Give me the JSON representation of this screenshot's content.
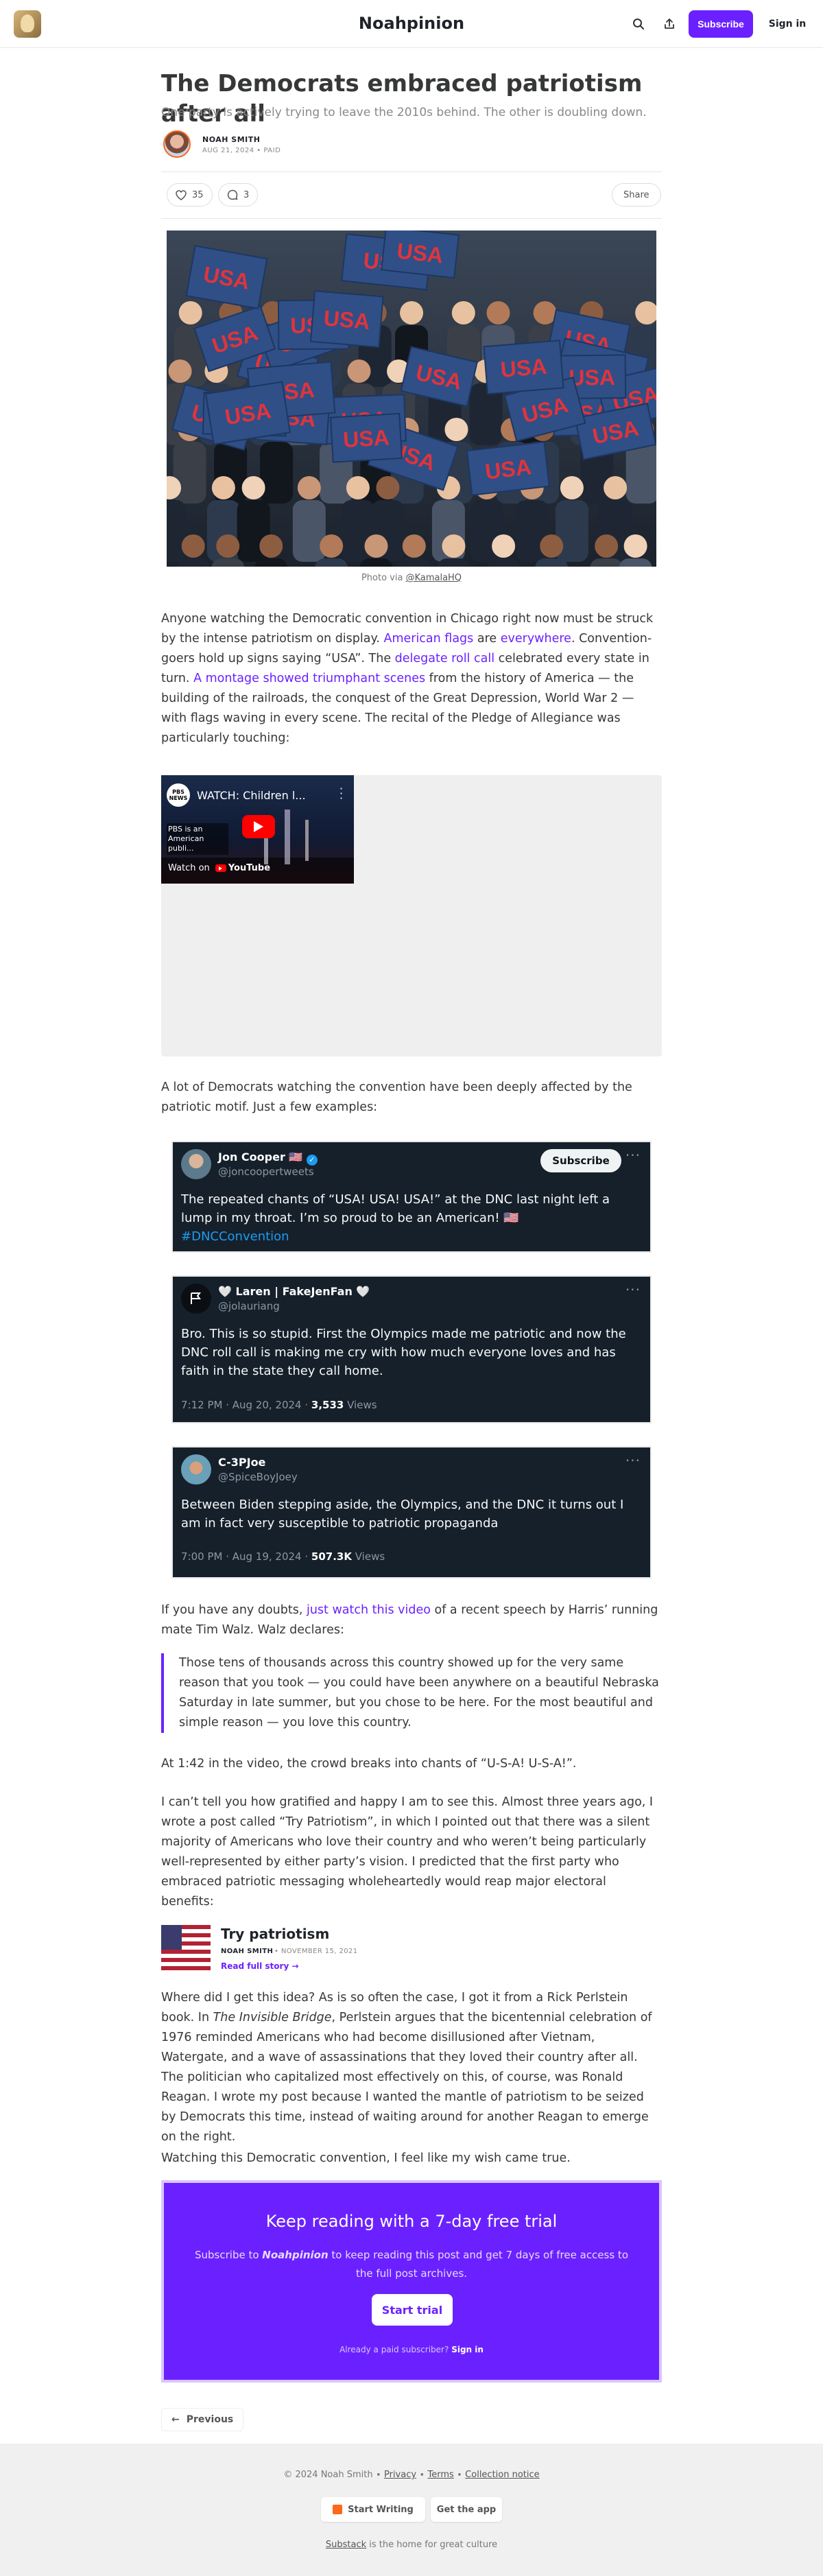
{
  "header": {
    "publication": "Noahpinion",
    "subscribe_label": "Subscribe",
    "signin_label": "Sign in",
    "icons": [
      "search-icon",
      "share-icon",
      "logo-icon"
    ]
  },
  "post": {
    "title": "The Democrats embraced patriotism after all",
    "subtitle": "One party is actively trying to leave the 2010s behind. The other is doubling down.",
    "author": "NOAH SMITH",
    "date": "AUG 21, 2024",
    "access": "PAID",
    "likes": "35",
    "comments": "3",
    "share_label": "Share"
  },
  "hero": {
    "caption_prefix": "Photo via ",
    "caption_link": "@KamalaHQ",
    "sign_text": "USA"
  },
  "para1": {
    "t1": "Anyone watching the Democratic convention in Chicago right now must be struck by the intense patriotism on display. ",
    "l1": "American flags",
    "t2": " are ",
    "l2": "everywhere",
    "t3": ". Convention-goers hold up signs saying “USA”. The ",
    "l3": "delegate roll call",
    "t4": " celebrated every state in turn. ",
    "l4": "A montage showed triumphant scenes",
    "t5": " from the history of America — the building of the railroads, the conquest of the Great Depression, World War 2 — with flags waving in every scene. The recital of the Pledge of Allegiance was particularly touching:"
  },
  "video": {
    "title": "WATCH: Children l...",
    "channel_badge": "PBS NEWS",
    "overlay": "PBS is an American publi...",
    "watch_on": "Watch on",
    "youtube": "YouTube"
  },
  "para2": "A lot of Democrats watching the convention have been deeply affected by the patriotic motif. Just a few examples:",
  "tweets": [
    {
      "name": "Jon Cooper 🇺🇸",
      "handle": "@joncoopertweets",
      "text": "The repeated chants of “USA! USA! USA!” at the DNC last night left a lump in my throat. I’m so proud to be an American! 🇺🇸",
      "hashtag": "#DNCConvention",
      "subscribe_label": "Subscribe"
    },
    {
      "name": "🤍 Laren | FakeJenFan 🤍",
      "handle": "@jolauriang",
      "text": "Bro. This is so stupid. First the Olympics made me patriotic and now the DNC roll call is making me cry with how much everyone loves and has faith in the state they call home.",
      "time": "7:12 PM · Aug 20, 2024 · ",
      "views": "3,533",
      "views_label": " Views"
    },
    {
      "name": "C-3PJoe",
      "handle": "@SpiceBoyJoey",
      "text": "Between Biden stepping aside, the Olympics, and the DNC it turns out I am in fact very susceptible to patriotic propaganda",
      "time": "7:00 PM · Aug 19, 2024 · ",
      "views": "507.3K",
      "views_label": " Views"
    }
  ],
  "para3": {
    "t1": "If you have any doubts, ",
    "l1": "just watch this video",
    "t2": " of a recent speech by Harris’ running mate Tim Walz. Walz declares:"
  },
  "quote": "Those tens of thousands across this country showed up for the very same reason that you took — you could have been anywhere on a beautiful Nebraska Saturday in late summer, but you chose to be here. For the most beautiful and simple reason — you love this country.",
  "para4": "At 1:42 in the video, the crowd breaks into chants of “U-S-A! U-S-A!”.",
  "para5": "I can’t tell you how gratified and happy I am to see this. Almost three years ago, I wrote a post called “Try Patriotism”, in which I pointed out that there was a silent majority of Americans who love their country and who weren’t being particularly well-represented by either party’s vision. I predicted that the first party who embraced patriotic messaging wholeheartedly would reap major electoral benefits:",
  "embed": {
    "title": "Try patriotism",
    "author": "NOAH SMITH",
    "date": "NOVEMBER 15, 2021",
    "link": "Read full story"
  },
  "para6": {
    "t1": "Where did I get this idea? As is so often the case, I got it from a Rick Perlstein book. In ",
    "i1": "The Invisible Bridge",
    "t2": ", Perlstein argues that the bicentennial celebration of 1976 reminded Americans who had become disillusioned after Vietnam, Watergate, and a wave of assassinations that they loved their country after all. The politician who capitalized most effectively on this, of course, was Ronald Reagan. I wrote my post because I wanted the mantle of patriotism to be seized by Democrats this time, instead of waiting around for another Reagan to emerge on the right."
  },
  "para7": "Watching this Democratic convention, I feel like my wish came true.",
  "paywall": {
    "title": "Keep reading with a 7-day free trial",
    "text1": "Subscribe to ",
    "pub": "Noahpinion",
    "text2": " to keep reading this post and get 7 days of free access to the full post archives.",
    "button": "Start trial",
    "already": "Already a paid subscriber? ",
    "signin": "Sign in",
    "color": "#6b21ff"
  },
  "nav": {
    "previous": "Previous"
  },
  "footer": {
    "copyright": "© 2024 Noah Smith",
    "privacy": "Privacy",
    "terms": "Terms",
    "collection": "Collection notice",
    "start_writing": "Start Writing",
    "get_app": "Get the app",
    "substack": "Substack",
    "tagline": " is the home for great culture"
  }
}
